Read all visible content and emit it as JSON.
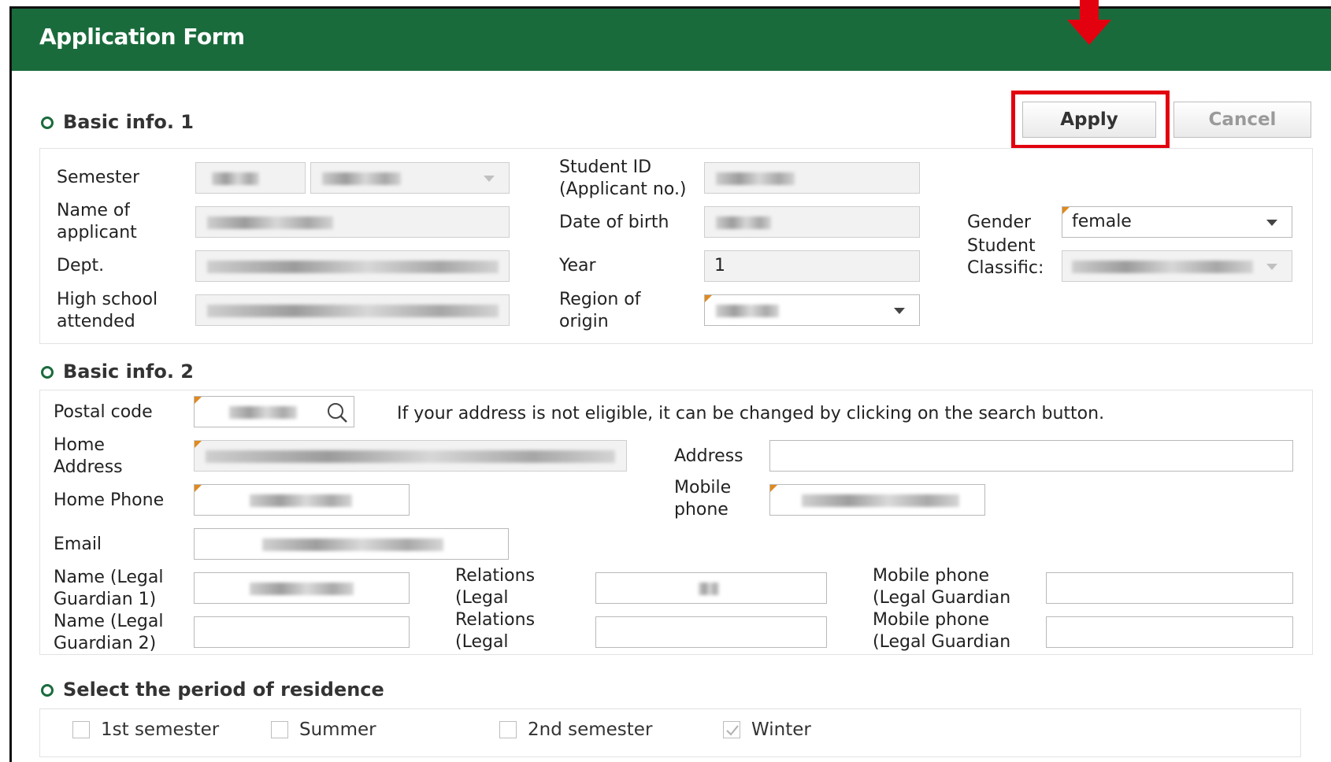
{
  "header": {
    "title": "Application Form"
  },
  "buttons": {
    "apply": "Apply",
    "cancel": "Cancel"
  },
  "sections": {
    "basic1": "Basic info. 1",
    "basic2": "Basic info. 2",
    "period": "Select the period of residence"
  },
  "basic1": {
    "semester_label": "Semester",
    "name_label_1": "Name of",
    "name_label_2": "applicant",
    "dept_label": "Dept.",
    "highschool_label_1": "High school",
    "highschool_label_2": "attended",
    "studentid_label_1": "Student ID",
    "studentid_label_2": "(Applicant no.)",
    "dob_label": "Date of birth",
    "year_label": "Year",
    "year_value": "1",
    "region_label_1": "Region of",
    "region_label_2": "origin",
    "gender_label": "Gender",
    "gender_value": "female",
    "classific_label_1": "Student",
    "classific_label_2": "Classific:"
  },
  "basic2": {
    "postal_label": "Postal code",
    "postal_note": "If your address is not eligible, it can be changed by clicking on the search button.",
    "home_address_label_1": "Home",
    "home_address_label_2": "Address",
    "address_label": "Address",
    "home_phone_label": "Home Phone",
    "mobile_label_1": "Mobile",
    "mobile_label_2": "phone",
    "email_label": "Email",
    "g1_name_label_1": "Name (Legal",
    "g1_name_label_2": "Guardian 1)",
    "g2_name_label_1": "Name (Legal",
    "g2_name_label_2": "Guardian 2)",
    "g1_rel_label_1": "Relations",
    "g1_rel_label_2": "(Legal",
    "g2_rel_label_1": "Relations",
    "g2_rel_label_2": "(Legal",
    "g1_mobile_label_1": "Mobile phone",
    "g1_mobile_label_2": "(Legal Guardian",
    "g2_mobile_label_1": "Mobile phone",
    "g2_mobile_label_2": "(Legal Guardian"
  },
  "period": {
    "options": [
      "1st semester",
      "Summer",
      "2nd semester",
      "Winter"
    ],
    "checked": [
      false,
      false,
      false,
      true
    ]
  },
  "colors": {
    "header": "#1a6b3c",
    "highlight": "#e3000f",
    "required_marker": "#e08a1e"
  }
}
